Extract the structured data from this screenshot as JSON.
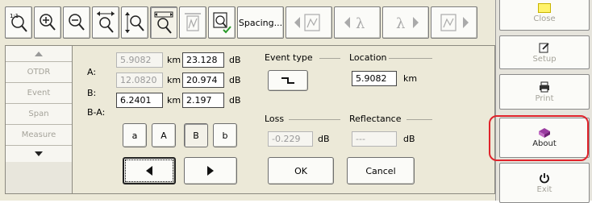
{
  "toolbar": {
    "spacing_label": "Spacing...",
    "buttons": [
      {
        "icon": "zoom-fit-icon"
      },
      {
        "icon": "zoom-in-icon"
      },
      {
        "icon": "zoom-out-icon"
      },
      {
        "icon": "horizontal-zoom-icon"
      },
      {
        "icon": "vertical-zoom-icon"
      },
      {
        "icon": "zoom-area-icon"
      },
      {
        "icon": "trace-view-icon"
      },
      {
        "icon": "event-check-icon"
      }
    ]
  },
  "sidebar": {
    "items": [
      "OTDR",
      "Event",
      "Span",
      "Measure"
    ]
  },
  "markers": {
    "a_label": "A:",
    "b_label": "B:",
    "ba_label": "B-A:",
    "a_km": "5.9082",
    "b_km": "12.0820",
    "ba_km": "6.2401",
    "a_db": "23.128",
    "b_db": "20.974",
    "ba_db": "2.197",
    "km_unit": "km",
    "db_unit": "dB",
    "marker_buttons": [
      "a",
      "A",
      "B",
      "b"
    ]
  },
  "event": {
    "type_label": "Event type",
    "location_label": "Location",
    "location_value": "5.9082",
    "location_unit": "km",
    "loss_label": "Loss",
    "loss_value": "-0.229",
    "loss_unit": "dB",
    "reflectance_label": "Reflectance",
    "reflectance_value": "---",
    "reflectance_unit": "dB"
  },
  "actions": {
    "ok": "OK",
    "cancel": "Cancel"
  },
  "commands": {
    "close": "Close",
    "setup": "Setup",
    "print": "Print",
    "about": "About",
    "exit": "Exit"
  },
  "colors": {
    "highlight": "#e0232b",
    "panel": "#ece9d8"
  }
}
